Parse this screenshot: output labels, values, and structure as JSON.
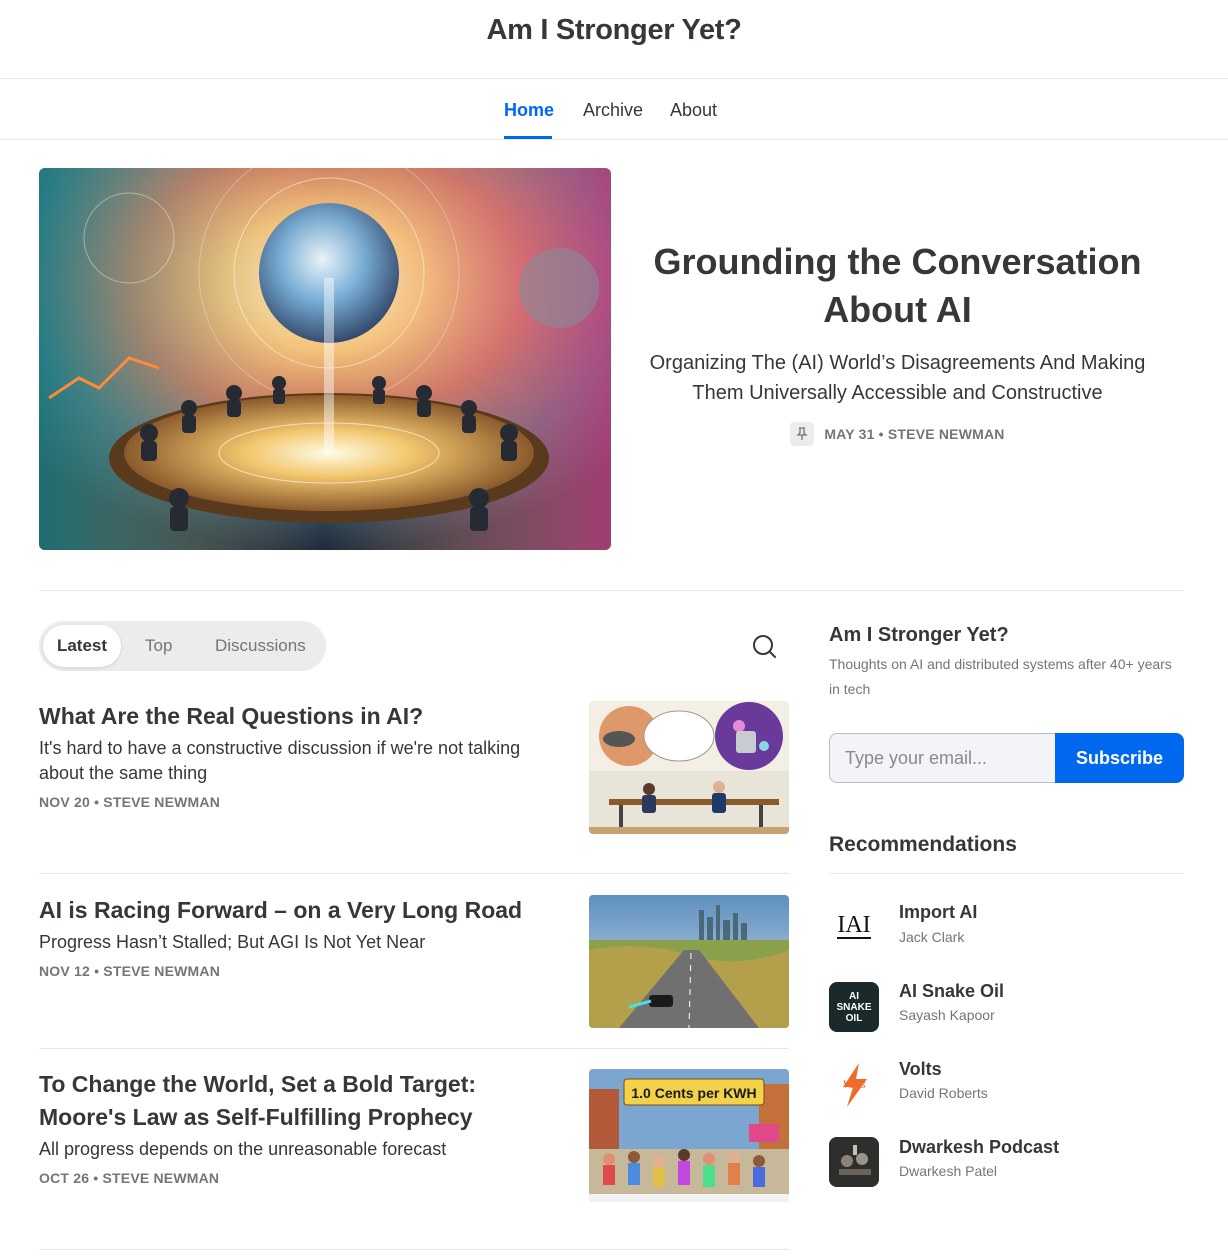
{
  "header": {
    "site_title": "Am I Stronger Yet?"
  },
  "nav": {
    "items": [
      "Home",
      "Archive",
      "About"
    ],
    "active": "Home"
  },
  "featured": {
    "title": "Grounding the Conversation About AI",
    "subtitle": "Organizing The (AI) World’s Disagreements And Making Them Universally Accessible and Constructive",
    "date": "MAY 31",
    "author": "STEVE NEWMAN",
    "pin_icon": "pin-icon"
  },
  "tabs": [
    "Latest",
    "Top",
    "Discussions"
  ],
  "search_icon": "search-icon",
  "posts": [
    {
      "title": "What Are the Real Questions in AI?",
      "subtitle": "It's hard to have a constructive discussion if we're not talking about the same thing",
      "date": "NOV 20",
      "author": "STEVE NEWMAN"
    },
    {
      "title": "AI is Racing Forward – on a Very Long Road",
      "subtitle": "Progress Hasn’t Stalled; But AGI Is Not Yet Near",
      "date": "NOV 12",
      "author": "STEVE NEWMAN"
    },
    {
      "title": "To Change the World, Set a Bold Target: Moore's Law as Self-Fulfilling Prophecy",
      "subtitle": "All progress depends on the unreasonable forecast",
      "date": "OCT 26",
      "author": "STEVE NEWMAN",
      "image_banner": "1.0 Cents per KWH"
    }
  ],
  "sidebar": {
    "title": "Am I Stronger Yet?",
    "description": "Thoughts on AI and distributed systems after 40+ years in tech",
    "email_placeholder": "Type your email...",
    "subscribe_label": "Subscribe",
    "recommendations_title": "Recommendations",
    "recommendations": [
      {
        "name": "Import AI",
        "author": "Jack Clark",
        "logo_text": "IAI"
      },
      {
        "name": "AI Snake Oil",
        "author": "Sayash Kapoor",
        "logo_text": "AI SNAKE OIL"
      },
      {
        "name": "Volts",
        "author": "David Roberts",
        "logo_text": "Volts"
      },
      {
        "name": "Dwarkesh Podcast",
        "author": "Dwarkesh Patel"
      }
    ]
  },
  "colors": {
    "accent": "#0068ef",
    "text": "#363737",
    "muted": "#757575"
  }
}
